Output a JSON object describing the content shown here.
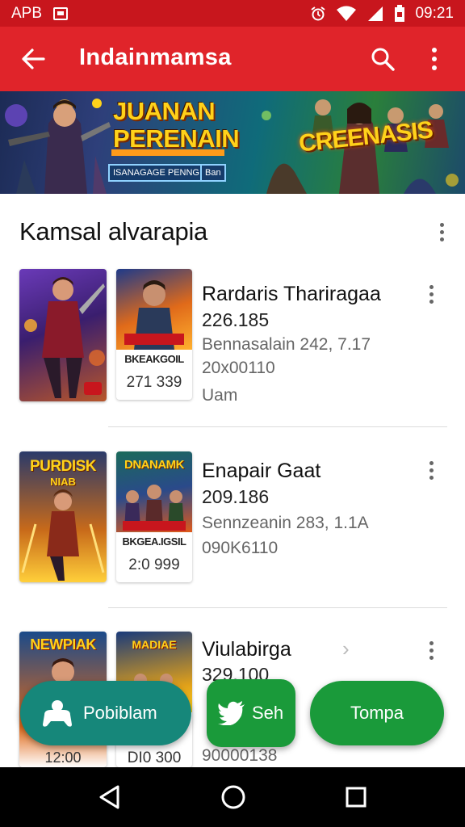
{
  "status_bar": {
    "left_text": "APB",
    "time": "09:21",
    "icons": [
      "notification-icon",
      "alarm-icon",
      "wifi-icon",
      "signal-icon",
      "battery-icon"
    ]
  },
  "app_bar": {
    "title": "Indainmamsa",
    "icons": [
      "back-arrow-icon",
      "search-icon",
      "overflow-menu-icon"
    ],
    "background": "#e0242a",
    "status_background": "#c8161d"
  },
  "banner": {
    "headline_line1": "JUANAN",
    "headline_line2": "PERENAIN",
    "button_left": "ISANAGAGE PENNG",
    "button_right": "Ban",
    "logo_text": "CREENASIS"
  },
  "section": {
    "title": "Kamsal alvarapia"
  },
  "items": [
    {
      "title": "Rardaris Thariragaa",
      "number": "226.185",
      "meta_line1": "Bennasalain 242, 7.17",
      "meta_line2": "20x00110",
      "meta_line3": "Uam",
      "card_label": "BKEAKGOIL",
      "card_price": "271 339"
    },
    {
      "title": "Enapair Gaat",
      "number": "209.186",
      "meta_line1": "Sennzeanin 283, 1.1A",
      "meta_line2": "090K6110",
      "poster_text_line1": "PURDISK",
      "poster_text_line2": "NIAB",
      "card_title": "DNANAMK",
      "card_label": "BKGEA.IGSIL",
      "card_price": "2:0 999"
    },
    {
      "title": "Viulabirga",
      "number": "329.100",
      "meta_line2": "90000138",
      "poster_text": "NEWPIAK",
      "poster_price": "12:00",
      "card_title": "MADIAE",
      "card_price": "DI0 300"
    }
  ],
  "fabs": {
    "teal_label": "Pobiblam",
    "green_label": "Seh",
    "green2_label": "Tompa",
    "teal_color": "#16877a",
    "green_color": "#1a9a3a"
  },
  "nav_icons": [
    "back-triangle-icon",
    "home-circle-icon",
    "recents-square-icon"
  ]
}
